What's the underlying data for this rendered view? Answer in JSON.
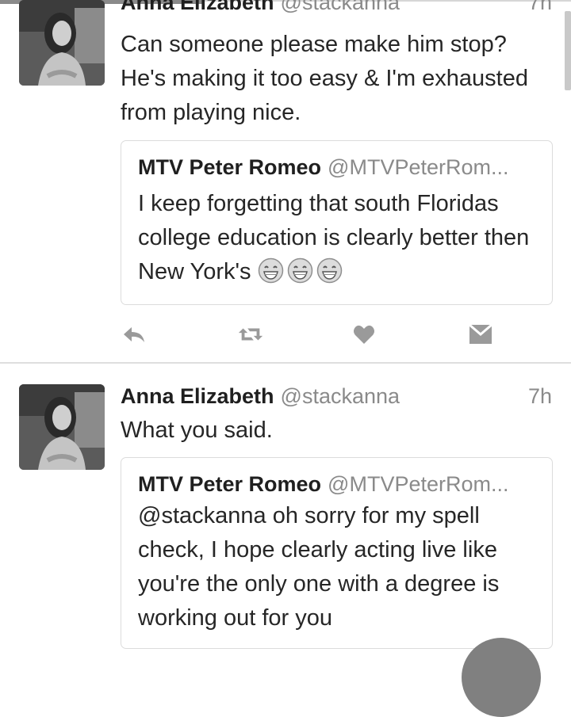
{
  "tweets": [
    {
      "display_name": "Anna Elizabeth",
      "handle": "@stackanna",
      "time": "7h",
      "text": "Can someone please make him stop? He's making it too easy & I'm exhausted from playing nice.",
      "quote": {
        "display_name": "MTV Peter Romeo",
        "handle": "@MTVPeterRom...",
        "text": "I keep forgetting that south Floridas college education is clearly better then New York's",
        "emoji": [
          "grinning-face",
          "grinning-face",
          "grinning-face"
        ]
      }
    },
    {
      "display_name": "Anna Elizabeth",
      "handle": "@stackanna",
      "time": "7h",
      "text": "What you said.",
      "quote": {
        "display_name": "MTV Peter Romeo",
        "handle": "@MTVPeterRom...",
        "text": "@stackanna oh sorry for my spell check, I hope clearly acting live like you're the only one with a degree is working out for you"
      }
    }
  ],
  "actions": [
    "reply-icon",
    "retweet-icon",
    "like-icon",
    "direct-message-icon"
  ],
  "colors": {
    "text": "#262626",
    "secondary": "#8a8a8a",
    "divider": "#dedede",
    "icon": "#9a9a9a"
  }
}
